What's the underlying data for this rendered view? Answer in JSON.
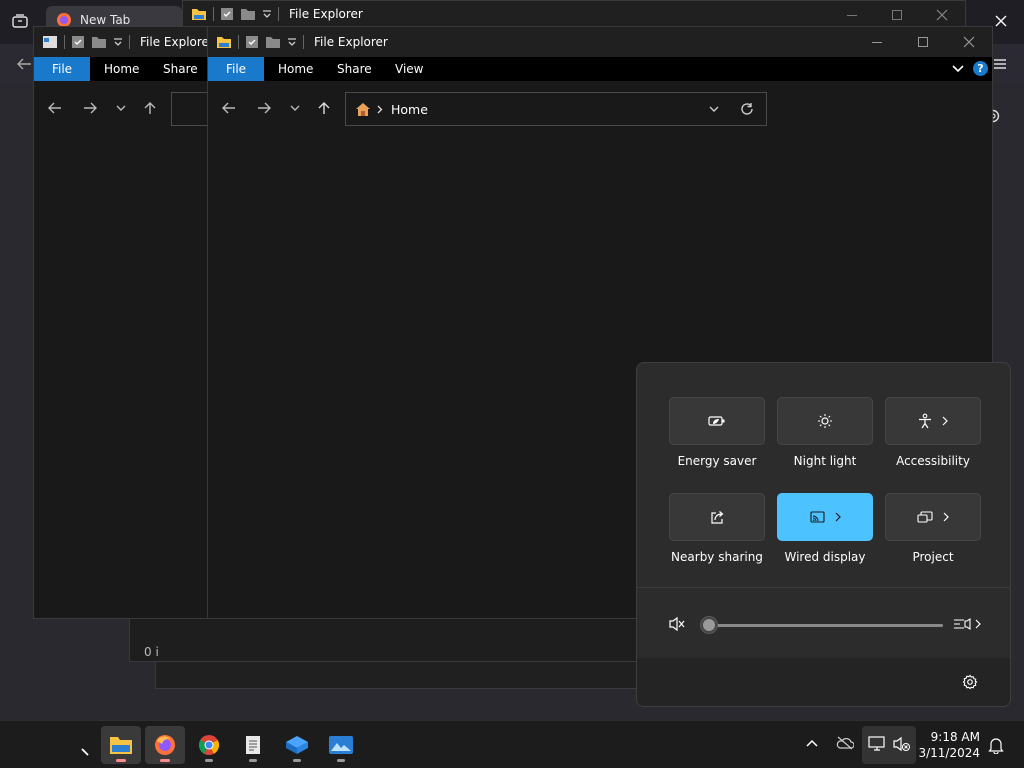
{
  "browser": {
    "tab_title": "New Tab"
  },
  "explorer_back": {
    "title": "File Explorer",
    "ribbon": {
      "file": "File",
      "home": "Home",
      "share": "Share"
    },
    "status_fragment": "0 i"
  },
  "explorer_front": {
    "title": "File Explorer",
    "ribbon": {
      "file": "File",
      "home": "Home",
      "share": "Share",
      "view": "View"
    },
    "address": {
      "location": "Home"
    }
  },
  "explorer_top": {
    "title": "File Explorer"
  },
  "quick_settings": {
    "tiles": [
      {
        "label": "Energy saver",
        "icon": "energy-saver-icon",
        "active": false,
        "has_chevron": false
      },
      {
        "label": "Night light",
        "icon": "night-light-icon",
        "active": false,
        "has_chevron": false
      },
      {
        "label": "Accessibility",
        "icon": "accessibility-icon",
        "active": false,
        "has_chevron": true
      },
      {
        "label": "Nearby sharing",
        "icon": "nearby-sharing-icon",
        "active": false,
        "has_chevron": false
      },
      {
        "label": "Wired display",
        "icon": "cast-icon",
        "active": true,
        "has_chevron": true
      },
      {
        "label": "Project",
        "icon": "project-icon",
        "active": false,
        "has_chevron": true
      }
    ],
    "volume": {
      "muted": true,
      "level": 0
    }
  },
  "taskbar": {
    "apps": [
      {
        "name": "File Explorer",
        "active": true
      },
      {
        "name": "Firefox",
        "active": true
      },
      {
        "name": "Google Chrome",
        "active": false
      },
      {
        "name": "Notepad",
        "active": false
      },
      {
        "name": "VirtualBox",
        "active": false
      },
      {
        "name": "Photos",
        "active": false
      }
    ],
    "clock": {
      "time": "9:18 AM",
      "date": "3/11/2024"
    }
  },
  "colors": {
    "accent": "#4cc2ff",
    "ribbon_file": "#1979ca",
    "background": "#191919"
  }
}
